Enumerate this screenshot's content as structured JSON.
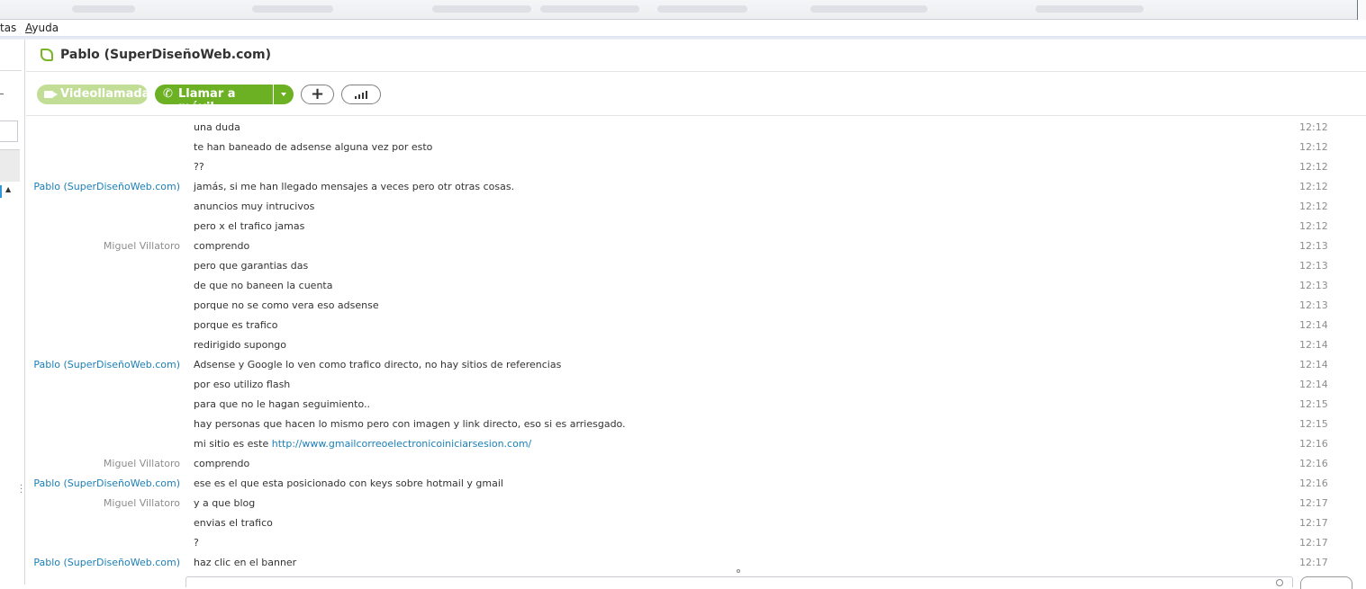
{
  "menu": {
    "items": [
      "tas",
      "Ayuda"
    ]
  },
  "header": {
    "contact_name": "Pablo (SuperDiseñoWeb.com)"
  },
  "toolbar": {
    "video_label": "Videollamada",
    "call_label": "Llamar a móvil"
  },
  "messages": [
    {
      "sender": "",
      "text": "una duda",
      "time": "12:12"
    },
    {
      "sender": "",
      "text": "te han baneado de adsense alguna vez por esto",
      "time": "12:12"
    },
    {
      "sender": "",
      "text": "??",
      "time": "12:12"
    },
    {
      "sender": "Pablo (SuperDiseñoWeb.com)",
      "text": "jamás, si me han llegado mensajes a veces pero otr otras cosas.",
      "time": "12:12"
    },
    {
      "sender": "",
      "text": "anuncios muy intrucivos",
      "time": "12:12"
    },
    {
      "sender": "",
      "text": "pero x el trafico jamas",
      "time": "12:12"
    },
    {
      "sender": "Miguel Villatoro",
      "text": "comprendo",
      "time": "12:13"
    },
    {
      "sender": "",
      "text": "pero que garantias das",
      "time": "12:13"
    },
    {
      "sender": "",
      "text": "de que no baneen la cuenta",
      "time": "12:13"
    },
    {
      "sender": "",
      "text": "porque no se como vera eso adsense",
      "time": "12:13"
    },
    {
      "sender": "",
      "text": "porque es trafico",
      "time": "12:14"
    },
    {
      "sender": "",
      "text": "redirigido supongo",
      "time": "12:14"
    },
    {
      "sender": "Pablo (SuperDiseñoWeb.com)",
      "text": "Adsense y Google lo ven como trafico directo, no hay sitios de referencias",
      "time": "12:14"
    },
    {
      "sender": "",
      "text": "por eso utilizo flash",
      "time": "12:14"
    },
    {
      "sender": "",
      "text": "para que no le hagan seguimiento..",
      "time": "12:15"
    },
    {
      "sender": "",
      "text": "hay personas que hacen lo mismo pero con imagen y link directo, eso si es arriesgado.",
      "time": "12:15"
    },
    {
      "sender": "",
      "text": "mi sitio es este ",
      "link": "http://www.gmailcorreoelectronicoiniciarsesion.com/",
      "time": "12:16"
    },
    {
      "sender": "Miguel Villatoro",
      "text": "comprendo",
      "time": "12:16"
    },
    {
      "sender": "Pablo (SuperDiseñoWeb.com)",
      "text": "ese es el que esta posicionado con keys sobre hotmail y gmail",
      "time": "12:16"
    },
    {
      "sender": "Miguel Villatoro",
      "text": "y a que blog",
      "time": "12:17"
    },
    {
      "sender": "",
      "text": "envias el trafico",
      "time": "12:17"
    },
    {
      "sender": "",
      "text": "?",
      "time": "12:17"
    },
    {
      "sender": "Pablo (SuperDiseñoWeb.com)",
      "text": "haz clic en el banner",
      "time": "12:17"
    }
  ],
  "colors": {
    "brand_green": "#6cb023",
    "disabled_green": "#c1dd96",
    "link_blue": "#1b7fb8",
    "muted_gray": "#8d8d8d"
  },
  "icons": {
    "status": "online-status-icon",
    "video": "video-camera-icon",
    "call": "phone-icon",
    "add": "plus-icon",
    "signal": "call-quality-icon"
  }
}
